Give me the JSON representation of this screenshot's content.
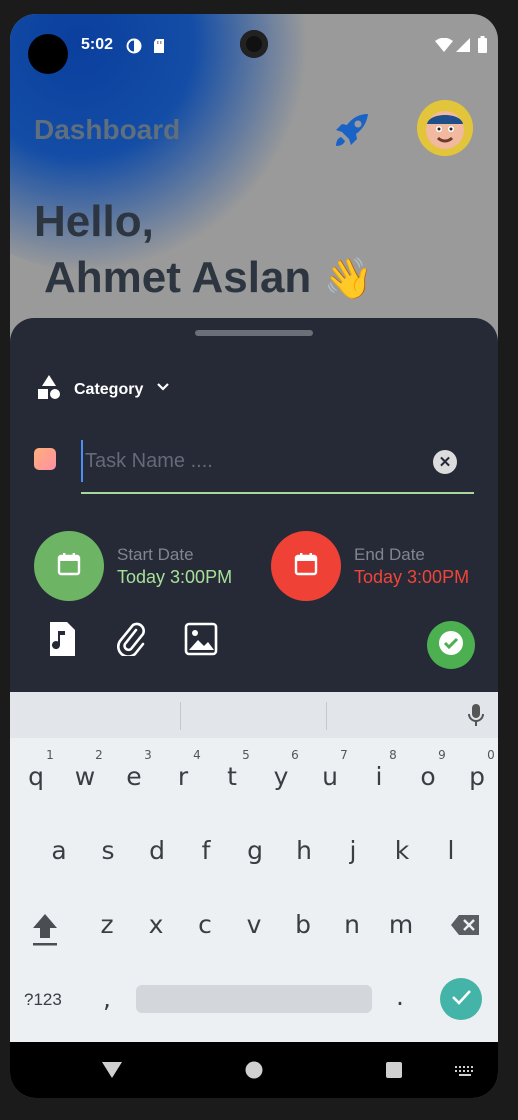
{
  "status_bar": {
    "time": "5:02",
    "icons": [
      "data-saver-icon",
      "sd-card-icon",
      "wifi-icon",
      "signal-icon",
      "battery-icon"
    ]
  },
  "header": {
    "title": "Dashboard",
    "rocket_icon": "rocket-icon",
    "avatar": "avatar"
  },
  "greeting": {
    "line1": "Hello,",
    "line2": "Ahmet Aslan",
    "emoji": "👋"
  },
  "sheet": {
    "category_label": "Category",
    "task_name_placeholder": "Task Name ....",
    "task_name_value": "",
    "start_date": {
      "label": "Start Date",
      "value": "Today 3:00PM",
      "color": "#a8e09a",
      "circle_color": "#6db464"
    },
    "end_date": {
      "label": "End Date",
      "value": "Today 3:00PM",
      "color": "#f0453a",
      "circle_color": "#ef4136"
    },
    "actions": [
      "audio-file-icon",
      "attachment-icon",
      "image-icon"
    ],
    "done_color": "#4caf50"
  },
  "keyboard": {
    "row1": [
      "q",
      "w",
      "e",
      "r",
      "t",
      "y",
      "u",
      "i",
      "o",
      "p"
    ],
    "row1_hints": [
      "1",
      "2",
      "3",
      "4",
      "5",
      "6",
      "7",
      "8",
      "9",
      "0"
    ],
    "row2": [
      "a",
      "s",
      "d",
      "f",
      "g",
      "h",
      "j",
      "k",
      "l"
    ],
    "row3": [
      "z",
      "x",
      "c",
      "v",
      "b",
      "n",
      "m"
    ],
    "symbols_label": "?123",
    "comma": ",",
    "period": ".",
    "accent": "#44b3a8"
  }
}
